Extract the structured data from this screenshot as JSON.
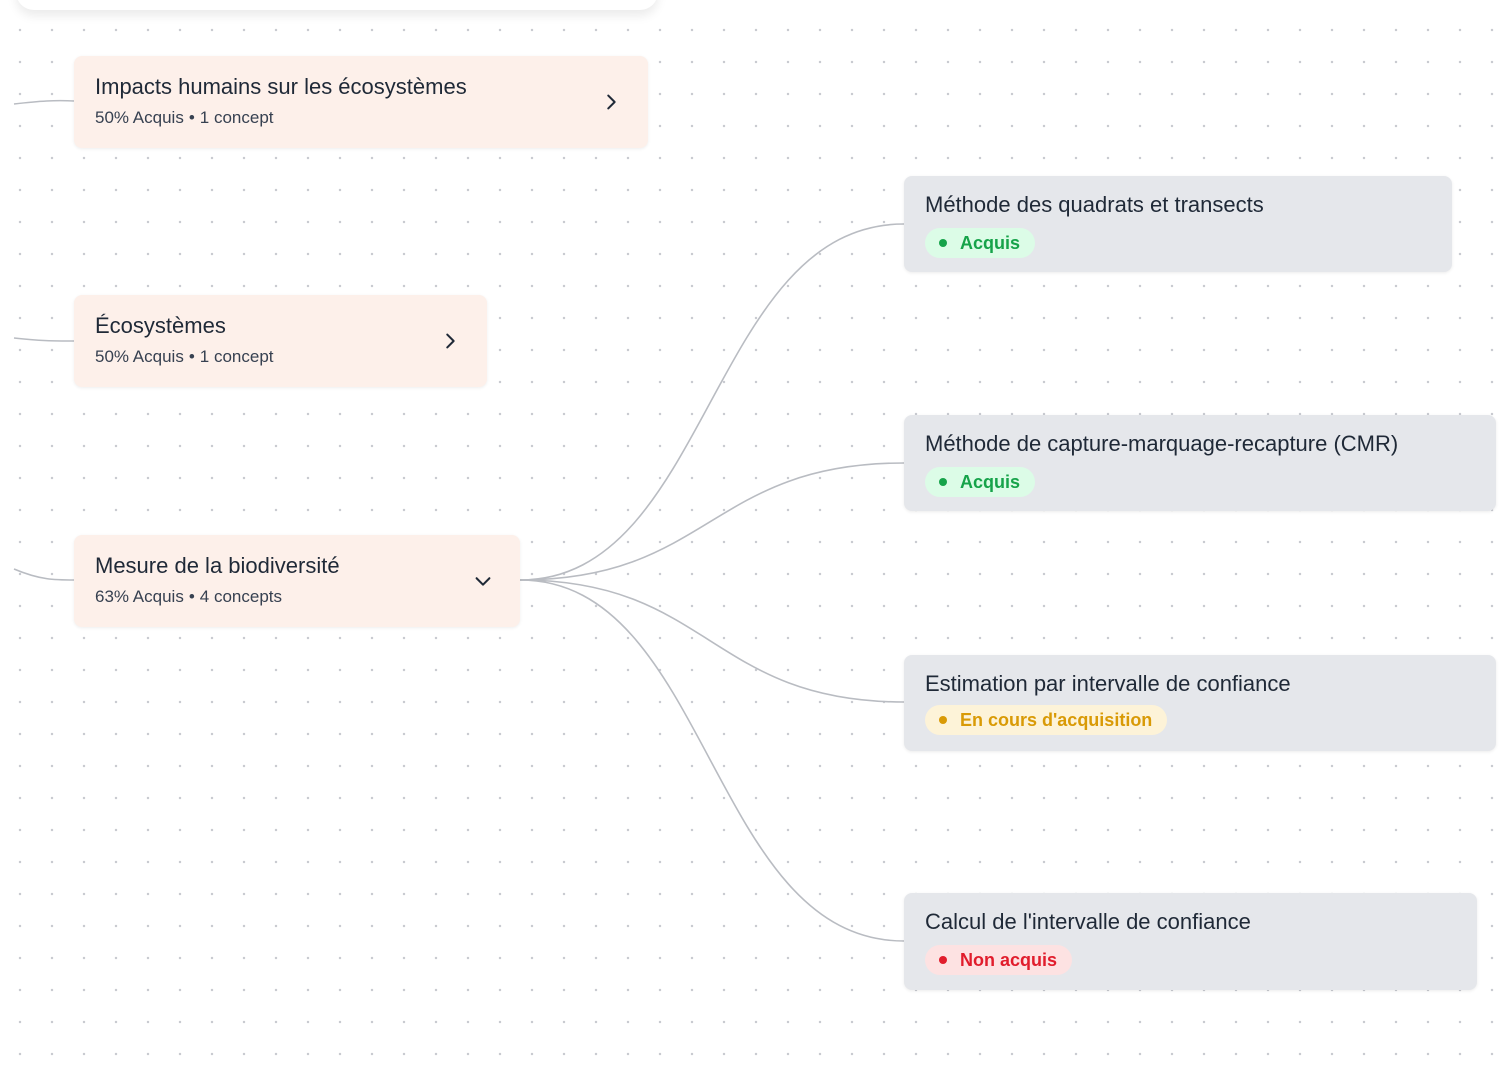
{
  "map": {
    "topics": [
      {
        "title": "Impacts humains sur les écosystèmes",
        "progress": "50% Acquis",
        "separator": "•",
        "concepts": "1 concept",
        "chevron": "chevron-right-icon"
      },
      {
        "title": "Écosystèmes",
        "progress": "50% Acquis",
        "separator": "•",
        "concepts": "1 concept",
        "chevron": "chevron-right-icon"
      },
      {
        "title": "Mesure de la biodiversité",
        "progress": "63% Acquis",
        "separator": "•",
        "concepts": "4 concepts",
        "chevron": "chevron-down-icon"
      }
    ],
    "concepts": [
      {
        "title": "Méthode des quadrats et transects",
        "status": "Acquis",
        "status_color": "#16a34a"
      },
      {
        "title": "Méthode de capture-marquage-recapture (CMR)",
        "status": "Acquis",
        "status_color": "#16a34a"
      },
      {
        "title": "Estimation par intervalle de confiance",
        "status": "En cours d'acquisition",
        "status_color": "#d99a06"
      },
      {
        "title": "Calcul de l'intervalle de confiance",
        "status": "Non acquis",
        "status_color": "#e11d2c"
      }
    ]
  },
  "colors": {
    "topic_background": "#fdf0ea",
    "concept_background": "#e5e7eb",
    "edge": "#b9bcc2"
  }
}
